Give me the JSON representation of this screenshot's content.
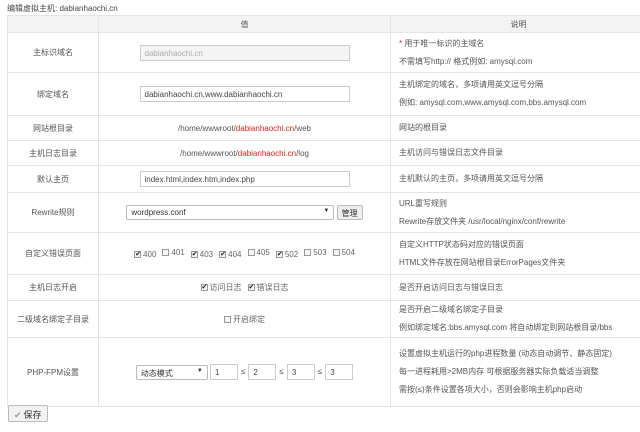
{
  "title": "编辑虚拟主机: dabianhaochi.cn",
  "headers": {
    "value": "值",
    "desc": "说明"
  },
  "rows": {
    "main_domain": {
      "label": "主标识域名",
      "value": "dabianhaochi.cn",
      "desc1": "用于唯一标识的主域名",
      "desc2": "不需填写http:// 格式例如: amysql.com"
    },
    "bind_domain": {
      "label": "绑定域名",
      "value": "dabianhaochi.cn,www.dabianhaochi.cn",
      "desc1": "主机绑定的域名，多项请用英文逗号分隔",
      "desc2": "例如: amysql.com,www.amysql.com,bbs.amysql.com"
    },
    "root_dir": {
      "label": "网站根目录",
      "prefix": "/home/wwwroot/",
      "domain": "dabianhaochi.cn",
      "suffix": "/web",
      "desc1": "网站的根目录"
    },
    "log_dir": {
      "label": "主机日志目录",
      "prefix": "/home/wwwroot/",
      "domain": "dabianhaochi.cn",
      "suffix": "/log",
      "desc1": "主机访问与错误日志文件目录"
    },
    "index": {
      "label": "默认主页",
      "value": "index.html,index.htm,index.php",
      "desc1": "主机默认的主页，多项请用英文逗号分隔"
    },
    "rewrite": {
      "label": "Rewrite规则",
      "selected": "wordpress.conf",
      "manage": "管理",
      "desc1": "URL重写规则",
      "desc2": "Rewrite存放文件夹 /usr/local/nginx/conf/rewrite"
    },
    "error_pages": {
      "label": "自定义错误页面",
      "codes": [
        {
          "code": "400",
          "checked": true
        },
        {
          "code": "401",
          "checked": false
        },
        {
          "code": "403",
          "checked": true
        },
        {
          "code": "404",
          "checked": true
        },
        {
          "code": "405",
          "checked": false
        },
        {
          "code": "502",
          "checked": true
        },
        {
          "code": "503",
          "checked": false
        },
        {
          "code": "504",
          "checked": false
        }
      ],
      "desc1": "自定义HTTP状态码对应的错误页面",
      "desc2": "HTML文件存放在网站根目录ErrorPages文件夹"
    },
    "logs": {
      "label": "主机日志开启",
      "access": "访问日志",
      "error": "错误日志",
      "access_checked": true,
      "error_checked": true,
      "desc1": "是否开启访问日志与错误日志"
    },
    "subdomain": {
      "label": "二级域名绑定子目录",
      "option": "开启绑定",
      "checked": false,
      "desc1": "是否开启二级域名绑定子目录",
      "desc2": "例如绑定域名:bbs.amysql.com 将自动绑定到网站根目录/bbs"
    },
    "fpm": {
      "label": "PHP-FPM设置",
      "mode": "动态模式",
      "v1": "1",
      "v2": "2",
      "v3": "3",
      "v4": "3",
      "le": "≤",
      "desc1": "设置虚拟主机运行的php进程数量 (动态自动调节、静态固定)",
      "desc2": "每一进程耗用>2MB内存 可根据服务器实际负载适当调整",
      "desc3": "需按(≤)条件设置各项大小，否则会影响主机php启动"
    }
  },
  "save": "保存"
}
